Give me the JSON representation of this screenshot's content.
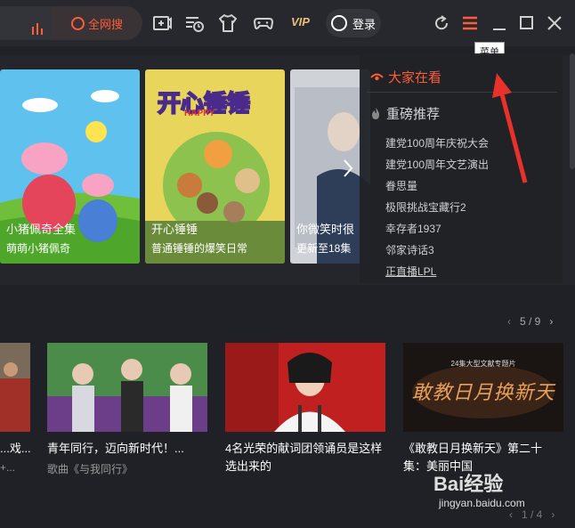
{
  "header": {
    "search_label": "全网搜",
    "vip_label": "VIP",
    "login_label": "登录",
    "tooltip_label": "菜单",
    "accent_color": "#ff5c38"
  },
  "banner": {
    "posters": [
      {
        "title": "小猪佩奇全集",
        "subtitle": "萌萌小猪佩奇"
      },
      {
        "title": "开心锤锤",
        "subtitle": "普通锤锤的爆笑日常",
        "logo_text": "开心锤锤",
        "logo_small": "HAPPY"
      },
      {
        "title": "你微笑时很",
        "subtitle": "更新至18集"
      }
    ]
  },
  "menu": {
    "header_label": "大家在看",
    "section_label": "重磅推荐",
    "items": [
      "建党100周年庆祝大会",
      "建党100周年文艺演出",
      "眷思量",
      "极限挑战宝藏行2",
      "幸存者1937",
      "邻家诗话3",
      "正直播LPL"
    ]
  },
  "row": {
    "pager": "5 / 9",
    "cards": [
      {
        "title": "...戏...",
        "subtitle": "+..."
      },
      {
        "title": "青年同行，迈向新时代！...",
        "subtitle": "歌曲《与我同行》"
      },
      {
        "title": "4名光荣的献词团领诵员是这样选出来的",
        "subtitle": ""
      },
      {
        "title": "《敢教日月换新天》第二十集：美丽中国",
        "subtitle": "",
        "overlay_text": "敢教日月换新天",
        "overlay_top": "24集大型文献专题片"
      }
    ],
    "bottom_pager": "1 / 4"
  },
  "watermark": {
    "logo": "Bai经验",
    "url": "jingyan.baidu.com"
  }
}
